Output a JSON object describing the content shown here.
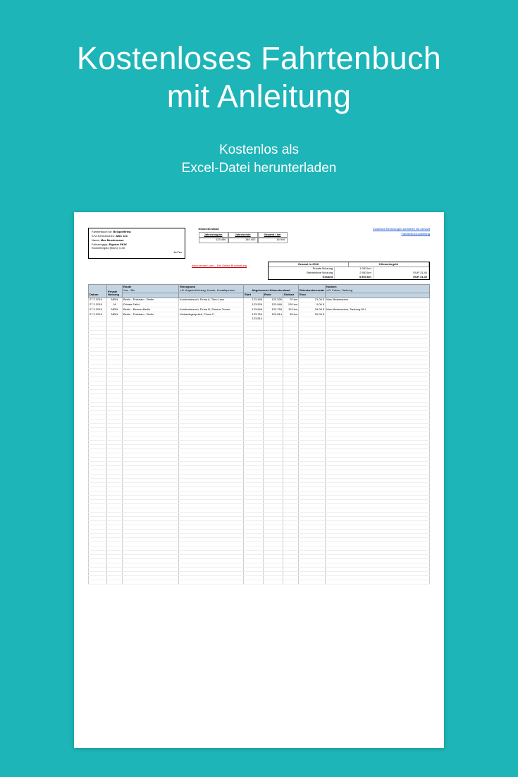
{
  "hero": {
    "title_line1": "Kostenloses Fahrtenbuch",
    "title_line2": "mit Anleitung",
    "sub_line1": "Kostenlos als",
    "sub_line2": "Excel-Datei herunterladen"
  },
  "info": {
    "title_label": "Fahrtenbuch für:",
    "title_value": "Beispielfirma",
    "kfz_label": "KFZ-Kennzeichen:",
    "kfz_value": "ABC 123",
    "name_label": "Name:",
    "name_value": "Max Mustermann",
    "type_label": "Fahrzeugtyp:",
    "type_value": "Eigener PKW",
    "kmgeld_label": "Kilometergeld (€/km):",
    "kmgeld_value": "0,30",
    "yes": "Ja/Yes"
  },
  "km": {
    "title": "Kilometerstand",
    "h1": "Jahresbeginn",
    "h2": "Jahresende",
    "h3": "Gesamt / km",
    "v1": "123.456",
    "v2": "140.402",
    "v3": "16.946"
  },
  "links": {
    "l1": "Kostenlos Rechnungen schreiben mit Zervant",
    "l2": "Fahrtenbuch-Anleitung"
  },
  "zervant": "www.zervant.com – Die Online-Buchhaltung",
  "summary": {
    "h1": "Gesamt in 2016",
    "h2": "Kilometergeld",
    "r1_lbl": "Private Nutzung",
    "r1_km": "1.053 km",
    "r1_eur": "",
    "r2_lbl": "Betriebliche Nutzung",
    "r2_km": "2.953 km",
    "r2_eur": "EUR 31,40",
    "r3_lbl": "Gesamt",
    "r3_km": "3.953 km",
    "r3_eur": "EUR 31,40"
  },
  "columns": {
    "datum": "Datum",
    "priv": "Private Nutzung",
    "route": "Route",
    "route_sub": "Von - Bis",
    "reise": "Reisegrund",
    "reise_sub": "z.B. Angebot/Vertrag, Kunde, Kontaktperson",
    "km_group": "Abgelesener Kilometerstand",
    "start": "Start",
    "ende": "Ende",
    "dist": "Distanz",
    "rk_group": "Reisekostenersatz",
    "euro": "Euro",
    "notiz": "Notizen",
    "notiz_sub": "z.B. Fahrer, Tankung"
  },
  "rows": [
    {
      "datum": "27.2.2016",
      "priv": "NEIN",
      "route": "Berlin - Potsdam - Berlin",
      "reise": "Kundenbesuch, Firma A, Timo Lanz",
      "start": "123.456",
      "ende": "123.526",
      "dist": "70 km",
      "euro": "21,00 €",
      "notiz": "Max Mustermann"
    },
    {
      "datum": "27.2.2016",
      "priv": "JA",
      "route": "Private Fahrt",
      "reise": "",
      "start": "123.526",
      "ende": "123.646",
      "dist": "120 km",
      "euro": "0,00 €",
      "notiz": ""
    },
    {
      "datum": "27.2.2016",
      "priv": "NEIN",
      "route": "Berlin - Bernau-Berlin",
      "reise": "Kundenbesuch, Firma B, Simone Treuer",
      "start": "123.646",
      "ende": "123.759",
      "dist": "113 km",
      "euro": "34,00 €",
      "notiz": "Max Mustermann, Tankung 50 l"
    },
    {
      "datum": "27.2.2016",
      "priv": "NEIN",
      "route": "Berlin - Potsdam - Berlin",
      "reise": "Verkaufsgespräch, Firma C,",
      "start": "123.759",
      "ende": "123.814",
      "dist": "55 km",
      "euro": "20,00 €",
      "notiz": ""
    },
    {
      "datum": "",
      "priv": "",
      "route": "",
      "reise": "",
      "start": "123.814",
      "ende": "",
      "dist": "",
      "euro": "",
      "notiz": ""
    }
  ],
  "empty_row_count": 62
}
